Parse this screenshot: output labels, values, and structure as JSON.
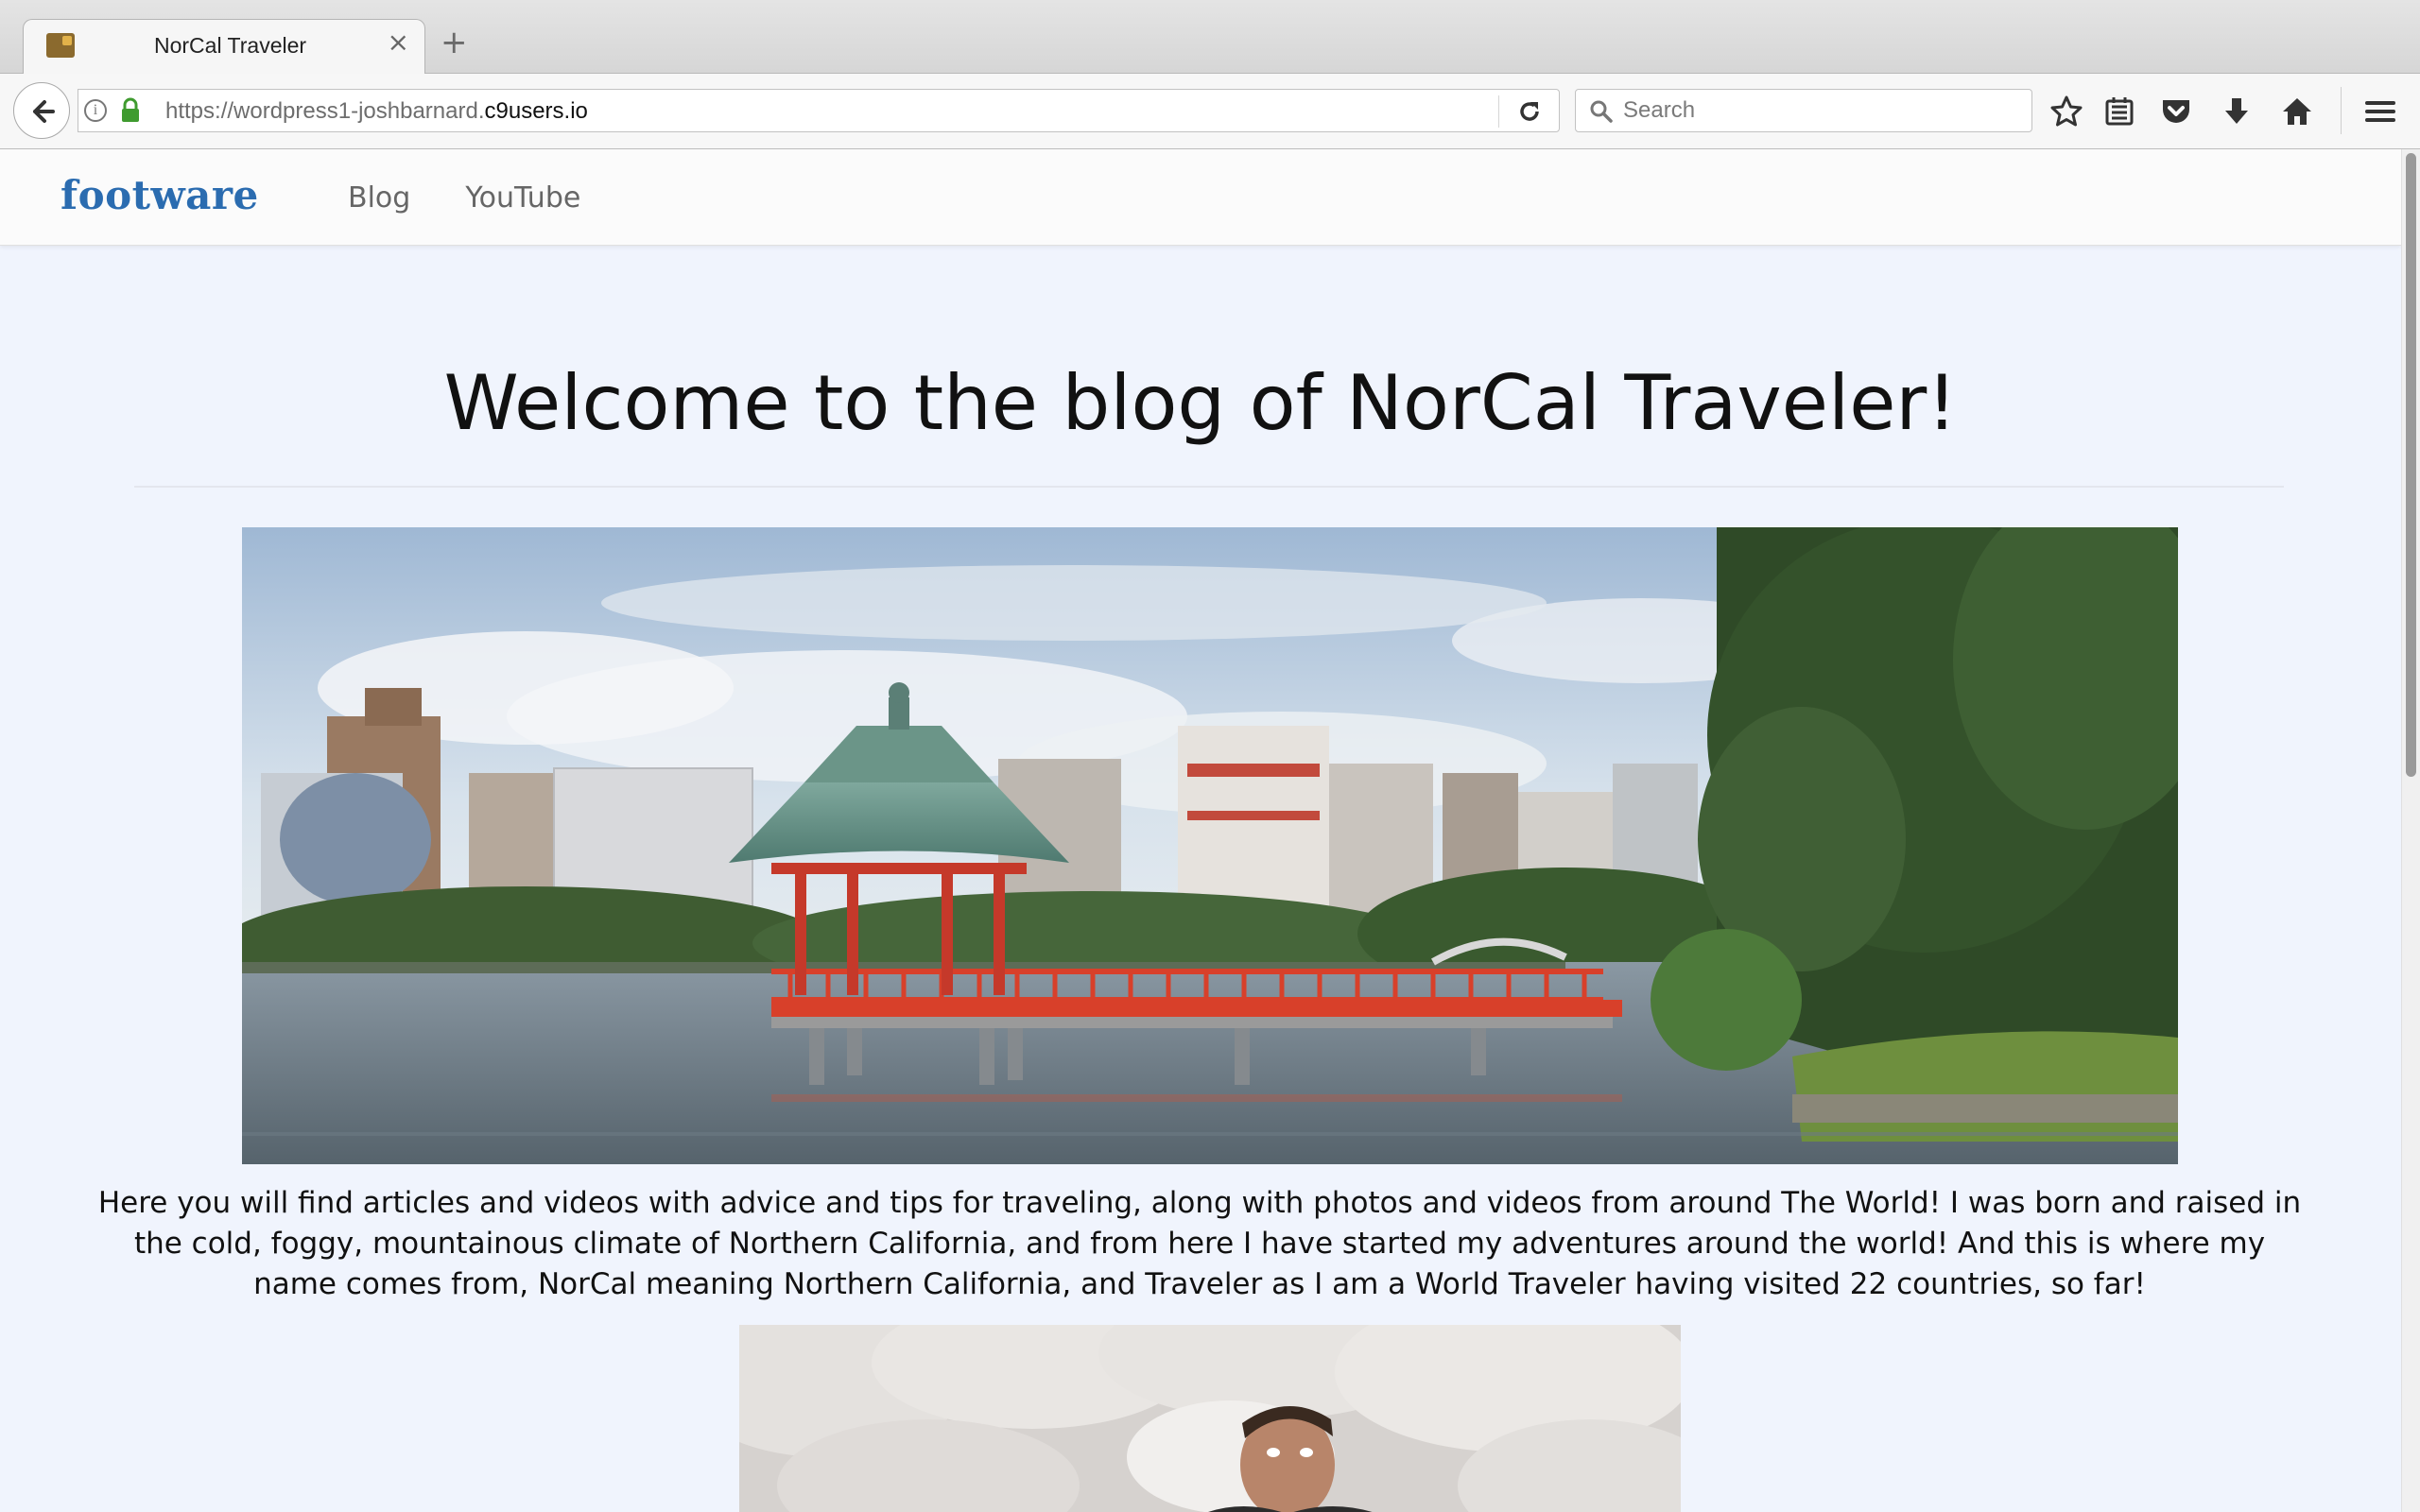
{
  "browser": {
    "tab": {
      "title": "NorCal Traveler"
    },
    "url": {
      "prefix": "https://wordpress1-joshbarnard.",
      "domain": "c9users.io"
    },
    "search": {
      "placeholder": "Search"
    }
  },
  "site": {
    "logo": "footware",
    "nav": [
      "Blog",
      "YouTube"
    ]
  },
  "page": {
    "title": "Welcome to the blog of NorCal Traveler!",
    "intro": "Here you will find articles and videos with advice and tips for traveling, along with photos and videos from around The World! I was born and raised in the cold, foggy, mountainous climate of Northern California, and from here I have started my adventures around the world!  And this is where my name comes from, NorCal meaning Northern California, and Traveler as I am a World Traveler having visited 22 countries, so far!"
  },
  "colors": {
    "accent": "#2b6cb0",
    "page_background": "#f0f4fd",
    "pavilion_red": "#d8402a"
  }
}
